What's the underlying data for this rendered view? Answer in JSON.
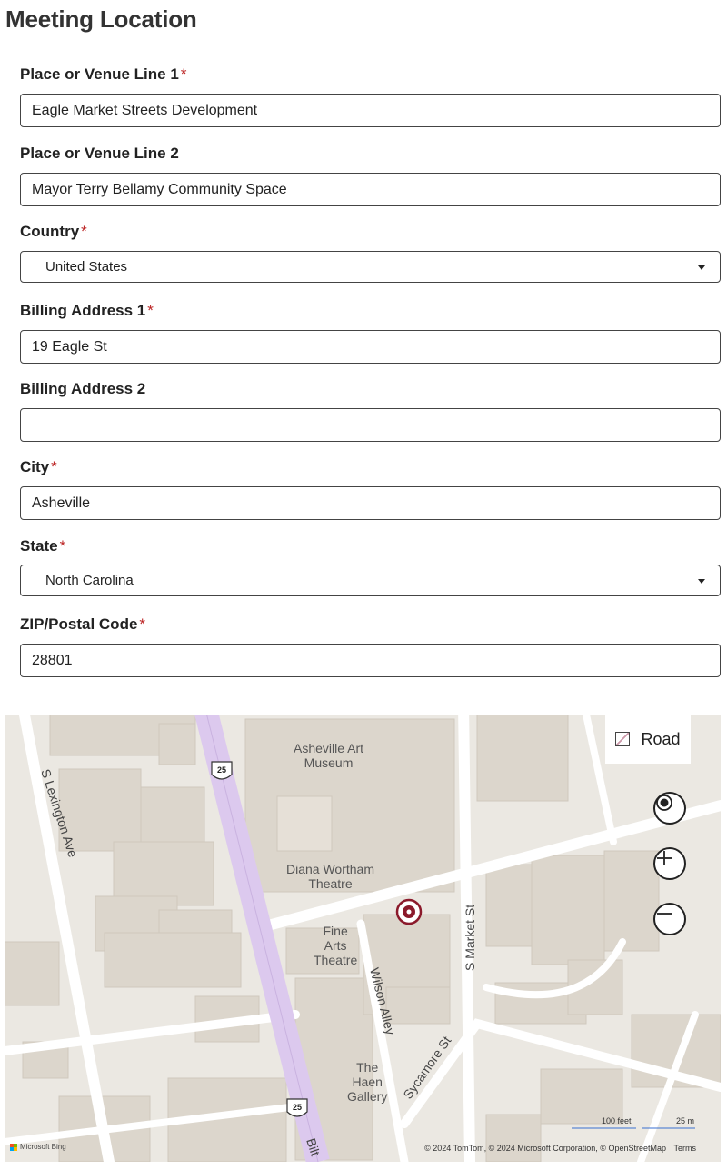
{
  "page": {
    "title": "Meeting Location"
  },
  "form": {
    "venue1": {
      "label": "Place or Venue Line 1",
      "required": "*",
      "value": "Eagle Market Streets Development"
    },
    "venue2": {
      "label": "Place or Venue Line 2",
      "value": "Mayor Terry Bellamy Community Space"
    },
    "country": {
      "label": "Country",
      "required": "*",
      "value": "United States"
    },
    "billing1": {
      "label": "Billing Address 1",
      "required": "*",
      "value": "19 Eagle St"
    },
    "billing2": {
      "label": "Billing Address 2",
      "value": ""
    },
    "city": {
      "label": "City",
      "required": "*",
      "value": "Asheville"
    },
    "state": {
      "label": "State",
      "required": "*",
      "value": "North Carolina"
    },
    "zip": {
      "label": "ZIP/Postal Code",
      "required": "*",
      "value": "28801"
    }
  },
  "map": {
    "style_button": "Road",
    "labels": {
      "art_museum": "Asheville Art\nMuseum",
      "theatre": "Diana Wortham\nTheatre",
      "fine_arts": "Fine\nArts\nTheatre",
      "haen": "The\nHaen\nGallery",
      "lexington": "S Lexington Ave",
      "market": "S Market St",
      "wilson": "Wilson Alley",
      "sycamore": "Sycamore St",
      "biltmore": "Bilt",
      "route": "25"
    },
    "scale_feet": "100 feet",
    "scale_meters": "25 m",
    "brand": "Microsoft Bing",
    "copyright": "© 2024 TomTom, © 2024 Microsoft Corporation, © OpenStreetMap",
    "terms": "Terms",
    "colors": {
      "highway": "#dcc9ee",
      "pin": "#8b1a2b",
      "roads": "#ffffff",
      "buildings": "#dcd6cc"
    }
  }
}
